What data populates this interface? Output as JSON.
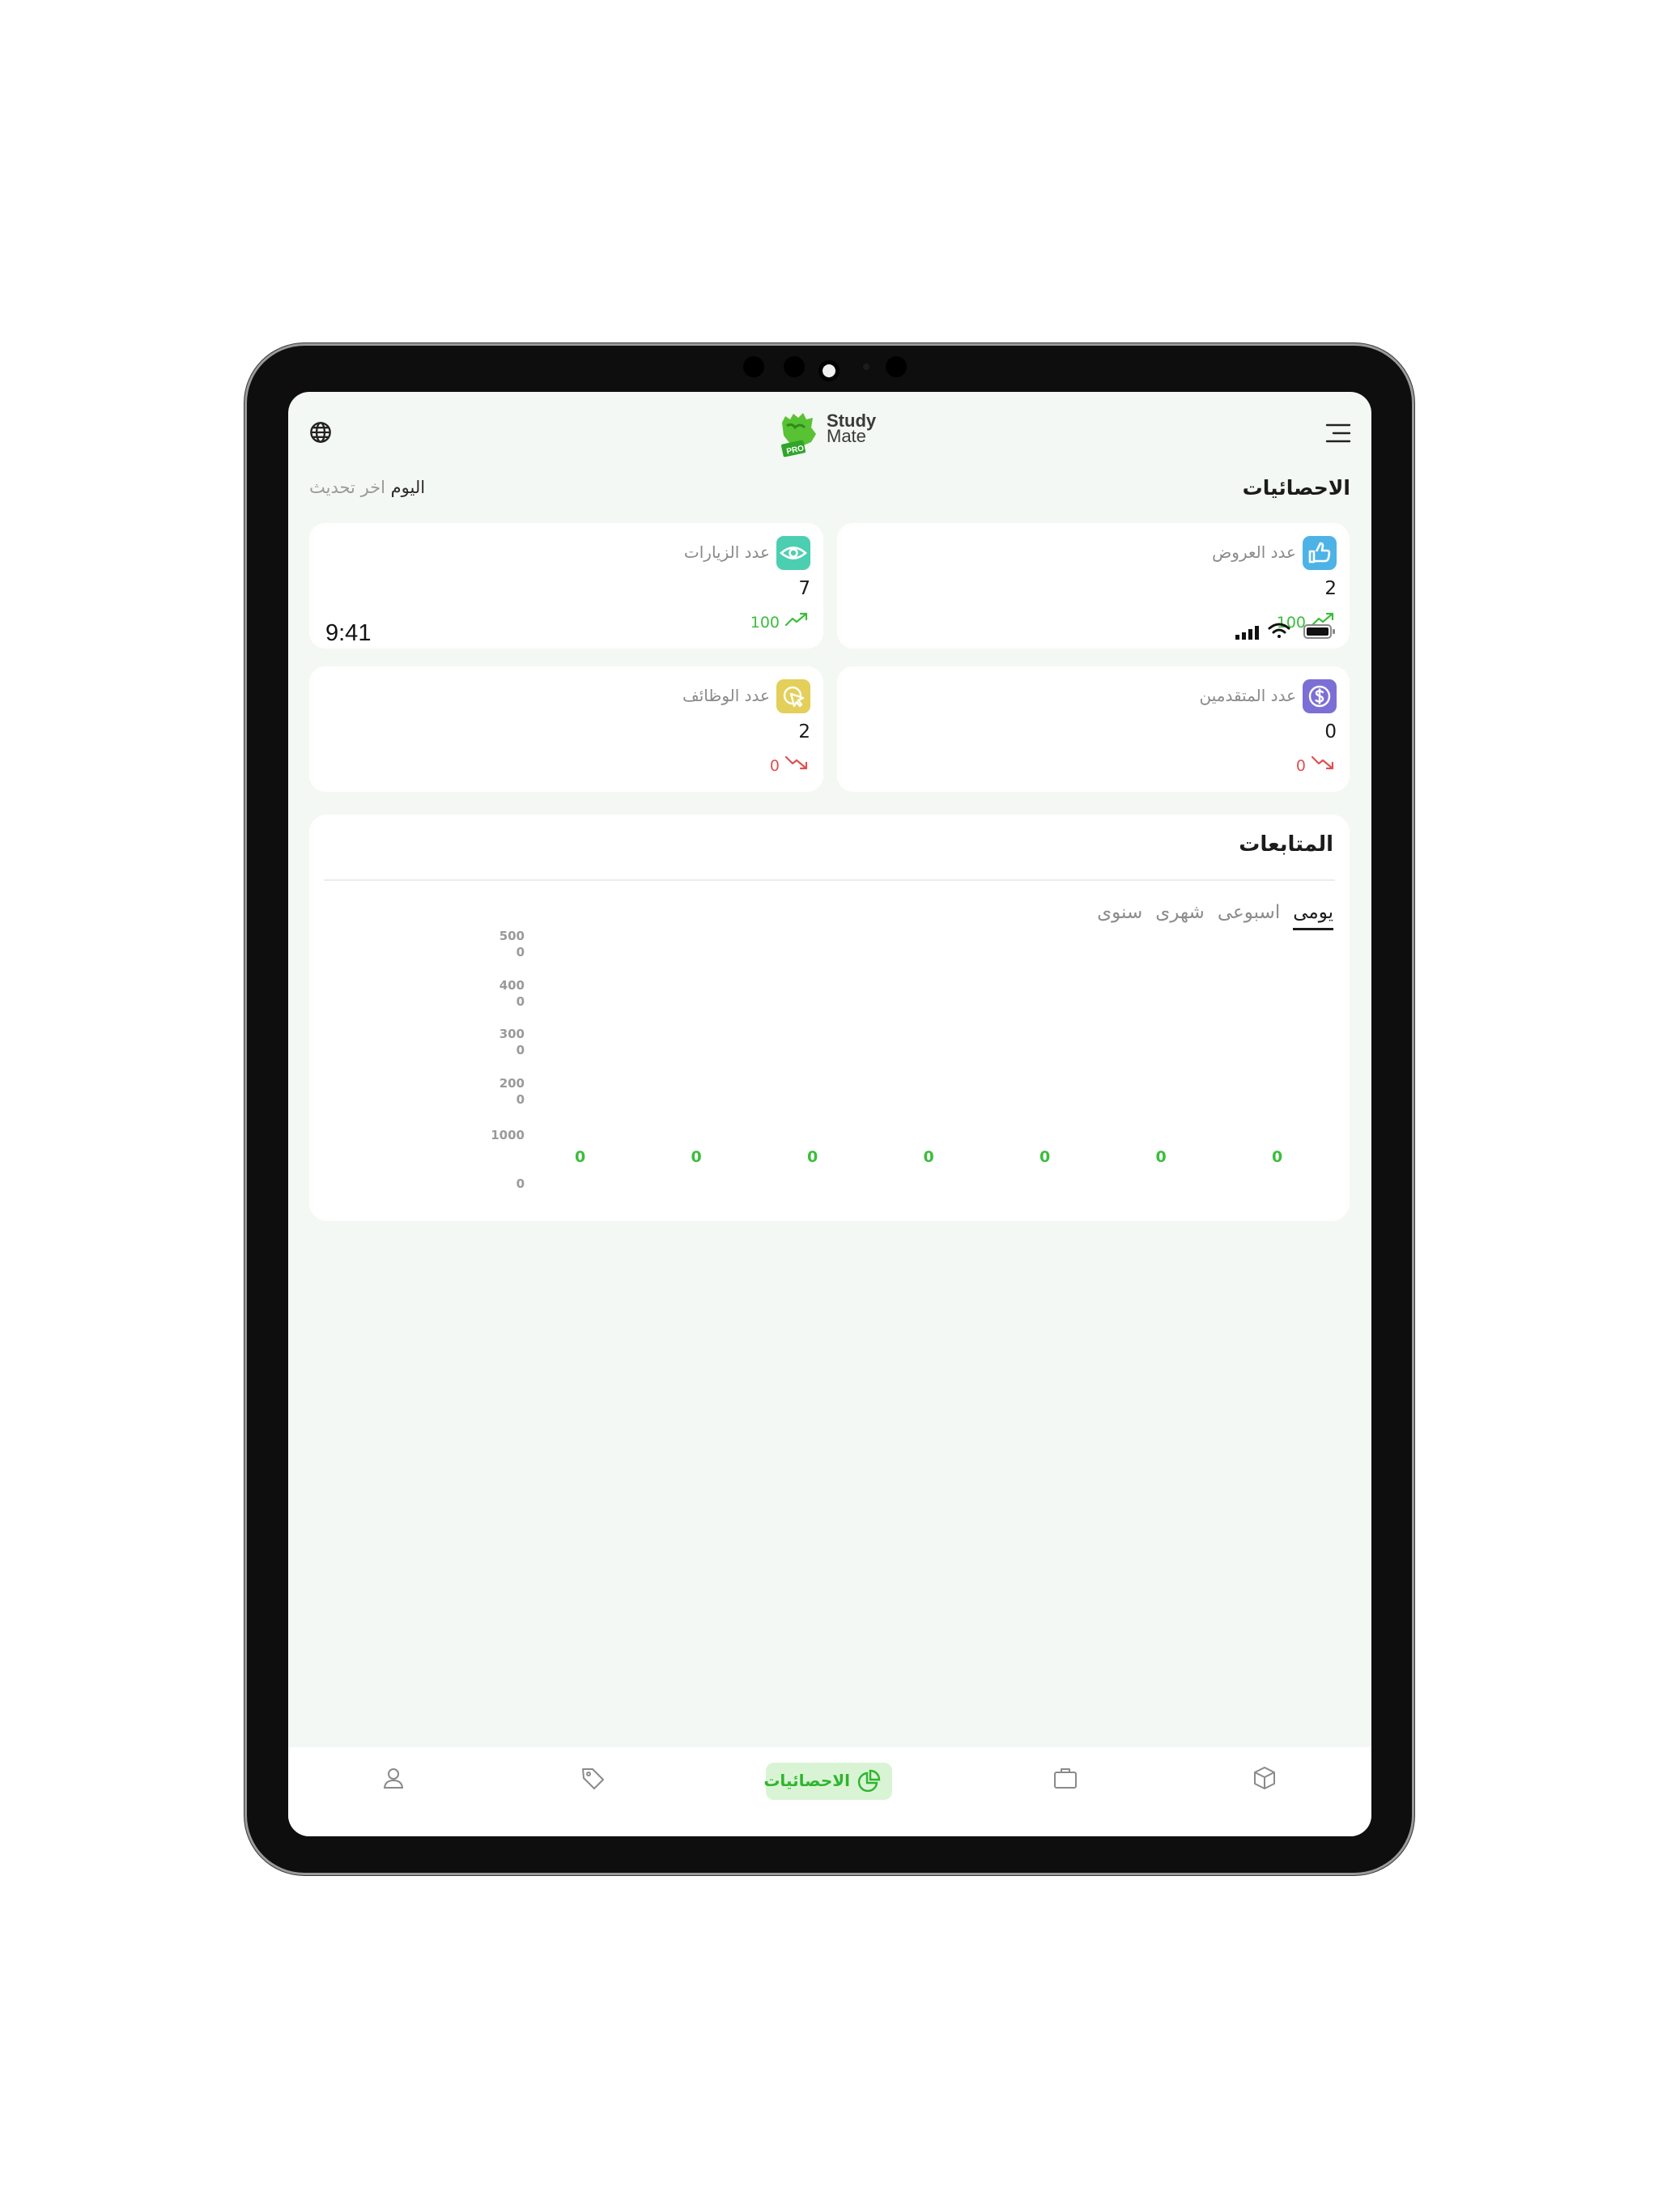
{
  "app": {
    "logo_line1": "Study",
    "logo_line2": "Mate",
    "logo_badge": "PRO"
  },
  "status_bar": {
    "time": "9:41"
  },
  "header": {
    "title": "الاحصائيات",
    "updated_prefix": "اخر تحديث",
    "updated_value": "اليوم"
  },
  "stats": [
    {
      "title": "عدد العروض",
      "value": "2",
      "trend": "100",
      "trend_dir": "up",
      "icon": "thumbs-up-icon",
      "color": "#4db3e6"
    },
    {
      "title": "عدد الزيارات",
      "value": "7",
      "trend": "100",
      "trend_dir": "up",
      "icon": "eye-icon",
      "color": "#4ccfb0"
    },
    {
      "title": "عدد المتقدمين",
      "value": "0",
      "trend": "0",
      "trend_dir": "down",
      "icon": "dollar-icon",
      "color": "#7b6fd6"
    },
    {
      "title": "عدد الوظائف",
      "value": "2",
      "trend": "0",
      "trend_dir": "down",
      "icon": "cursor-click-icon",
      "color": "#e3cf5a"
    }
  ],
  "follow": {
    "title": "المتابعات",
    "tabs": [
      "يومى",
      "اسبوعى",
      "شهرى",
      "سنوى"
    ],
    "active_tab": "يومى"
  },
  "chart_data": {
    "type": "bar",
    "ytick_labels": [
      [
        "500",
        "0"
      ],
      [
        "400",
        "0"
      ],
      [
        "300",
        "0"
      ],
      [
        "200",
        "0"
      ],
      [
        "1000"
      ],
      [
        "0"
      ]
    ],
    "ylim": [
      0,
      5000
    ],
    "values": [
      0,
      0,
      0,
      0,
      0,
      0,
      0
    ],
    "data_labels": [
      "0",
      "0",
      "0",
      "0",
      "0",
      "0",
      "0"
    ]
  },
  "nav": {
    "active_label": "الاحصائيات",
    "items": [
      "profile-icon",
      "tag-icon",
      "stats-icon",
      "briefcase-icon",
      "box-icon"
    ]
  }
}
